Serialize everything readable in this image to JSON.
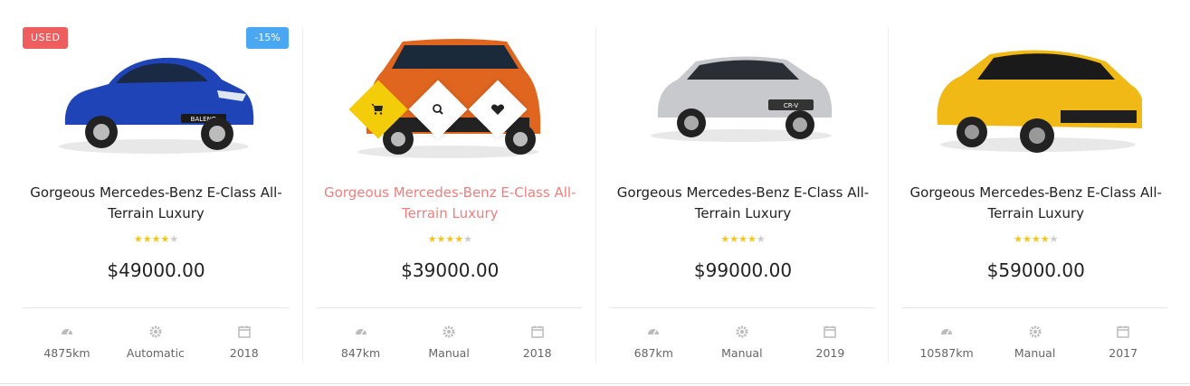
{
  "products": [
    {
      "badge_left": "USED",
      "badge_right": "-15%",
      "title": "Gorgeous Mercedes-Benz E-Class All-Terrain Luxury",
      "rating": 4,
      "price": "$49000.00",
      "specs": {
        "mileage": "4875km",
        "transmission": "Automatic",
        "year": "2018"
      },
      "car_color": "#1f44b8",
      "car_label": "BALENO"
    },
    {
      "title": "Gorgeous Mercedes-Benz E-Class All-Terrain Luxury",
      "rating": 4,
      "price": "$39000.00",
      "specs": {
        "mileage": "847km",
        "transmission": "Manual",
        "year": "2018"
      },
      "car_color": "#e0661f",
      "hovered": true
    },
    {
      "title": "Gorgeous Mercedes-Benz E-Class All-Terrain Luxury",
      "rating": 4,
      "price": "$99000.00",
      "specs": {
        "mileage": "687km",
        "transmission": "Manual",
        "year": "2019"
      },
      "car_color": "#c7c9cc",
      "car_label": "CR-V"
    },
    {
      "title": "Gorgeous Mercedes-Benz E-Class All-Terrain Luxury",
      "rating": 4,
      "price": "$59000.00",
      "specs": {
        "mileage": "10587km",
        "transmission": "Manual",
        "year": "2017"
      },
      "car_color": "#f0b915"
    }
  ],
  "colors": {
    "used_badge": "#ee5e5e",
    "discount_badge": "#4aa8f3",
    "highlight_title": "#ef7f7f",
    "cart_button": "#f3cc0a",
    "star_on": "#f5c518",
    "star_off": "#cccccc"
  },
  "icons": {
    "mileage": "speedometer-icon",
    "transmission": "gear-icon",
    "year": "calendar-icon",
    "cart": "cart-icon",
    "search": "search-icon",
    "wishlist": "heart-icon"
  }
}
